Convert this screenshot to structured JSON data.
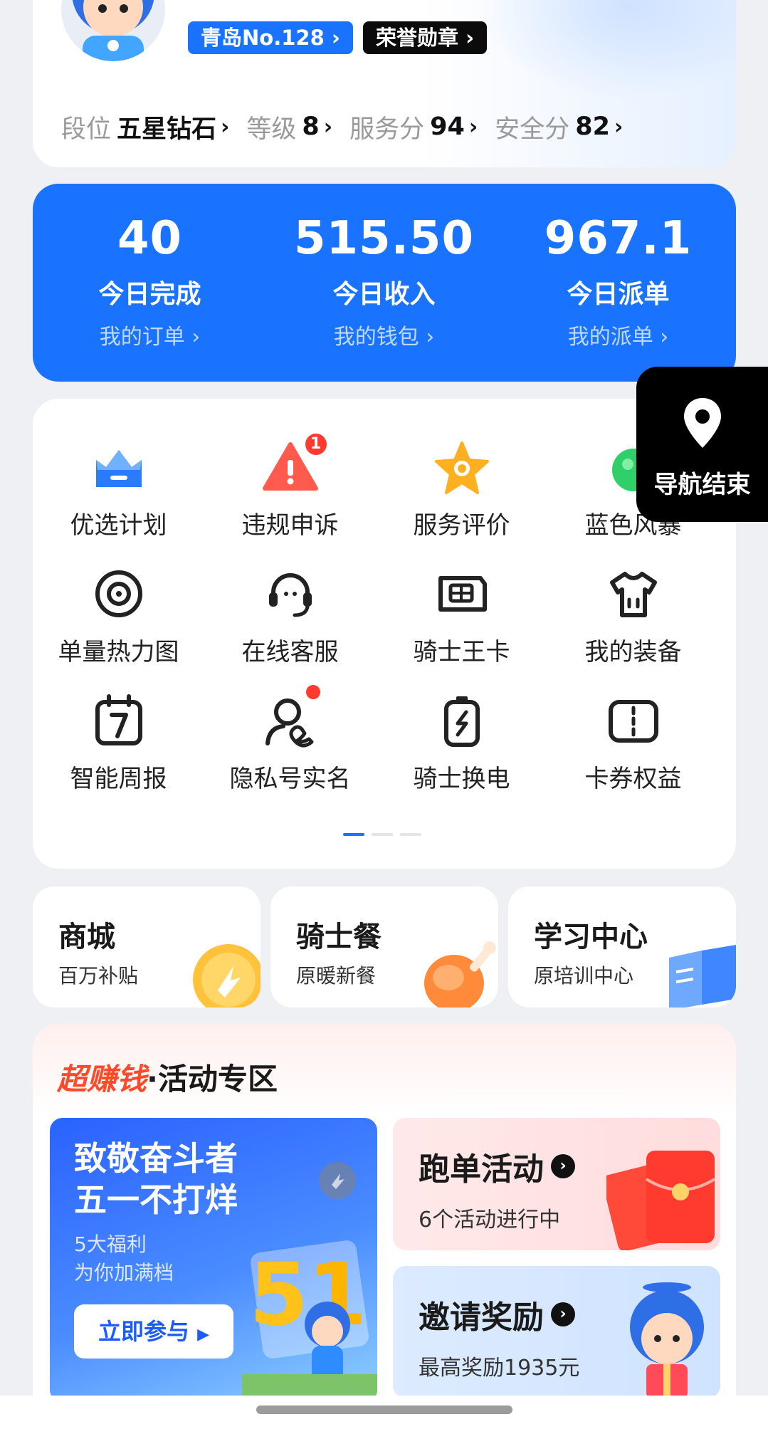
{
  "profile": {
    "city_rank": "青岛No.128",
    "honor_medal": "荣誉勋章",
    "stats": [
      {
        "key": "段位",
        "value": "五星钻石"
      },
      {
        "key": "等级",
        "value": "8"
      },
      {
        "key": "服务分",
        "value": "94"
      },
      {
        "key": "安全分",
        "value": "82"
      }
    ]
  },
  "summary": [
    {
      "number": "40",
      "label": "今日完成",
      "link": "我的订单"
    },
    {
      "number": "515.50",
      "label": "今日收入",
      "link": "我的钱包"
    },
    {
      "number": "967.1",
      "label": "今日派单",
      "link": "我的派单"
    }
  ],
  "grid": [
    {
      "label": "优选计划",
      "icon": "crown-icon"
    },
    {
      "label": "违规申诉",
      "icon": "warning-icon",
      "badge": "1"
    },
    {
      "label": "服务评价",
      "icon": "star-icon"
    },
    {
      "label": "蓝色风暴",
      "icon": "green-ball-icon"
    },
    {
      "label": "单量热力图",
      "icon": "heatmap-icon"
    },
    {
      "label": "在线客服",
      "icon": "headset-icon"
    },
    {
      "label": "骑士王卡",
      "icon": "sim-card-icon"
    },
    {
      "label": "我的装备",
      "icon": "tshirt-icon"
    },
    {
      "label": "智能周报",
      "icon": "calendar-7-icon"
    },
    {
      "label": "隐私号实名",
      "icon": "user-phone-icon"
    },
    {
      "label": "骑士换电",
      "icon": "battery-swap-icon"
    },
    {
      "label": "卡券权益",
      "icon": "coupon-icon"
    }
  ],
  "nav_end": {
    "label": "导航结束",
    "icon": "location-pin-icon"
  },
  "small_cards": [
    {
      "title": "商城",
      "sub": "百万补贴"
    },
    {
      "title": "骑士餐",
      "sub": "原暖新餐"
    },
    {
      "title": "学习中心",
      "sub": "原培训中心"
    }
  ],
  "activity": {
    "title_red": "超赚钱",
    "title_rest": "·活动专区",
    "big_banner": {
      "line1": "致敬奋斗者",
      "line2": "五一不打烊",
      "line3": "5大福利",
      "line4": "为你加满档",
      "button": "立即参与"
    },
    "run_orders": {
      "title": "跑单活动",
      "sub": "6个活动进行中"
    },
    "invite": {
      "title": "邀请奖励",
      "sub": "最高奖励1935元"
    }
  },
  "colors": {
    "brand_blue": "#1a73ff",
    "badge_red": "#ff3b30",
    "activity_red": "#ff4a2a"
  }
}
